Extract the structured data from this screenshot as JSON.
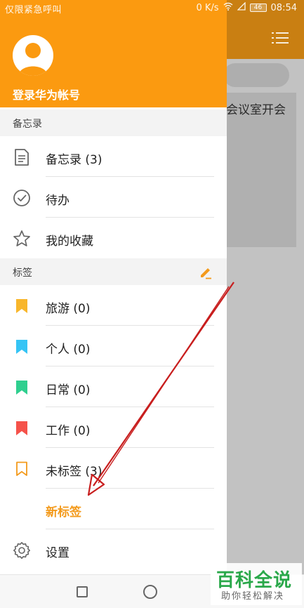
{
  "status_bar": {
    "left_text": "仅限紧急呼叫",
    "net_speed": "0 K/s",
    "battery": "46",
    "time": "08:54"
  },
  "background": {
    "card_text": "会议室开会"
  },
  "drawer": {
    "login_text": "登录华为帐号",
    "memo_section": "备忘录",
    "memo_items": [
      {
        "label": "备忘录 (3)",
        "icon": "note-icon"
      },
      {
        "label": "待办",
        "icon": "check-circle-icon"
      },
      {
        "label": "我的收藏",
        "icon": "star-icon"
      }
    ],
    "tag_section": "标签",
    "tag_items": [
      {
        "label": "旅游 (0)",
        "icon": "bookmark-icon",
        "color": "#f8b62b"
      },
      {
        "label": "个人 (0)",
        "icon": "bookmark-icon",
        "color": "#35c4f5"
      },
      {
        "label": "日常 (0)",
        "icon": "bookmark-icon",
        "color": "#2fcf8f"
      },
      {
        "label": "工作 (0)",
        "icon": "bookmark-icon",
        "color": "#f5524a"
      },
      {
        "label": "未标签 (3)",
        "icon": "bookmark-outline-icon",
        "color": "#f39a1c"
      }
    ],
    "new_tag": "新标签",
    "settings": "设置"
  },
  "watermark": {
    "main": "百科全说",
    "sub": "助你轻松解决"
  },
  "colors": {
    "accent": "#fb9a10",
    "new_tag": "#f39a1c",
    "arrow": "#c81e1e"
  }
}
